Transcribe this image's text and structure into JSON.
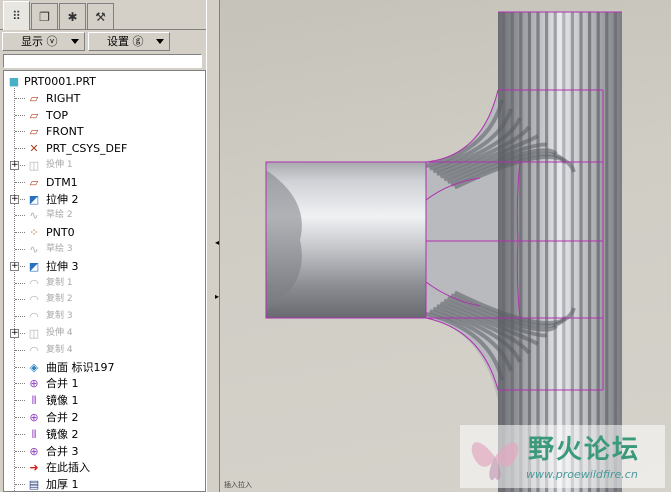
{
  "tabs": [
    {
      "icon": "model-tree-icon",
      "glyph": "⠿"
    },
    {
      "icon": "layers-icon",
      "glyph": "❐"
    },
    {
      "icon": "folder-icon",
      "glyph": "✱"
    },
    {
      "icon": "tools-icon",
      "glyph": "⚒"
    }
  ],
  "toolbar": {
    "display_label": "显示 ⓥ",
    "settings_label": "设置 ⓖ"
  },
  "tree": {
    "items": [
      {
        "label": "PRT0001.PRT",
        "icon": "part-icon",
        "glyph": "■",
        "color": "#4ab0c8",
        "dim": false,
        "expand": false
      },
      {
        "label": "RIGHT",
        "icon": "datum-plane-icon",
        "glyph": "▱",
        "color": "#b04020",
        "dim": false,
        "expand": false
      },
      {
        "label": "TOP",
        "icon": "datum-plane-icon",
        "glyph": "▱",
        "color": "#b04020",
        "dim": false,
        "expand": false
      },
      {
        "label": "FRONT",
        "icon": "datum-plane-icon",
        "glyph": "▱",
        "color": "#b04020",
        "dim": false,
        "expand": false
      },
      {
        "label": "PRT_CSYS_DEF",
        "icon": "csys-icon",
        "glyph": "✕",
        "color": "#b04020",
        "dim": false,
        "expand": false
      },
      {
        "label": "投伸 1",
        "icon": "protrusion-icon",
        "glyph": "◫",
        "color": "#b0b0b0",
        "dim": true,
        "expand": true
      },
      {
        "label": "DTM1",
        "icon": "datum-plane-icon",
        "glyph": "▱",
        "color": "#b04020",
        "dim": false,
        "expand": false
      },
      {
        "label": "拉伸 2",
        "icon": "extrude-icon",
        "glyph": "◩",
        "color": "#2a70c0",
        "dim": false,
        "expand": true
      },
      {
        "label": "草绘 2",
        "icon": "sketch-icon",
        "glyph": "∿",
        "color": "#b0b0b0",
        "dim": true,
        "expand": false
      },
      {
        "label": "PNT0",
        "icon": "datum-point-icon",
        "glyph": "⁘",
        "color": "#b04020",
        "dim": false,
        "expand": false
      },
      {
        "label": "草绘 3",
        "icon": "sketch-icon",
        "glyph": "∿",
        "color": "#b0b0b0",
        "dim": true,
        "expand": false
      },
      {
        "label": "拉伸 3",
        "icon": "extrude-icon",
        "glyph": "◩",
        "color": "#2a70c0",
        "dim": false,
        "expand": true
      },
      {
        "label": "复制 1",
        "icon": "copy-icon",
        "glyph": "◠",
        "color": "#b0b0b0",
        "dim": true,
        "expand": false
      },
      {
        "label": "复制 2",
        "icon": "copy-icon",
        "glyph": "◠",
        "color": "#b0b0b0",
        "dim": true,
        "expand": false
      },
      {
        "label": "复制 3",
        "icon": "copy-icon",
        "glyph": "◠",
        "color": "#b0b0b0",
        "dim": true,
        "expand": false
      },
      {
        "label": "投伸 4",
        "icon": "protrusion-icon",
        "glyph": "◫",
        "color": "#b0b0b0",
        "dim": true,
        "expand": true
      },
      {
        "label": "复制 4",
        "icon": "copy-icon",
        "glyph": "◠",
        "color": "#b0b0b0",
        "dim": true,
        "expand": false
      },
      {
        "label": "曲面 标识197",
        "icon": "surface-icon",
        "glyph": "◈",
        "color": "#2a80c0",
        "dim": false,
        "expand": false
      },
      {
        "label": "合并 1",
        "icon": "merge-icon",
        "glyph": "⊕",
        "color": "#9040c0",
        "dim": false,
        "expand": false
      },
      {
        "label": "镜像 1",
        "icon": "mirror-icon",
        "glyph": "⫴",
        "color": "#9040c0",
        "dim": false,
        "expand": false
      },
      {
        "label": "合并 2",
        "icon": "merge-icon",
        "glyph": "⊕",
        "color": "#9040c0",
        "dim": false,
        "expand": false
      },
      {
        "label": "镜像 2",
        "icon": "mirror-icon",
        "glyph": "⫴",
        "color": "#9040c0",
        "dim": false,
        "expand": false
      },
      {
        "label": "合并 3",
        "icon": "merge-icon",
        "glyph": "⊕",
        "color": "#9040c0",
        "dim": false,
        "expand": false
      },
      {
        "label": "在此插入",
        "icon": "insert-here-icon",
        "glyph": "➜",
        "color": "#d02020",
        "dim": false,
        "expand": false
      },
      {
        "label": "加厚 1",
        "icon": "thicken-icon",
        "glyph": "▤",
        "color": "#2a4080",
        "dim": false,
        "expand": false
      }
    ]
  },
  "viewport": {
    "status_text": "插入拉入",
    "watermark_title": "野火论坛",
    "watermark_url": "www.proewildfire.cn",
    "edge_color": "#b030b0",
    "surface_light": "#e6e8ec",
    "surface_dark": "#5a5c62"
  }
}
